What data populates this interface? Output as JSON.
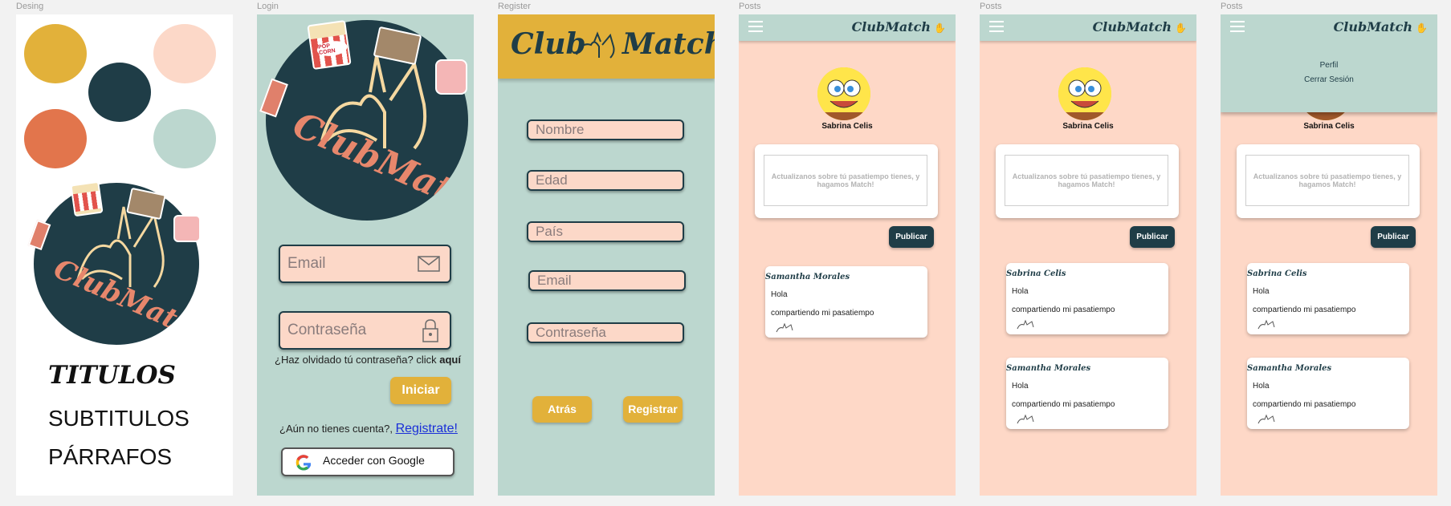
{
  "frames": {
    "design_label": "Desing",
    "login_label": "Login",
    "register_label": "Register",
    "posts_label": "Posts"
  },
  "colors": {
    "gold": "#e2b13a",
    "navy": "#1f3d47",
    "peach": "#fcd8c8",
    "orange": "#e2754c",
    "mint": "#bcd7cf"
  },
  "design": {
    "titles": "TITULOS",
    "subtitles": "SUBTITULOS",
    "paragraphs": "PÁRRAFOS"
  },
  "logo": {
    "script": "ClubMatch",
    "popcorn": "POP CORN"
  },
  "login": {
    "email_placeholder": "Email",
    "password_placeholder": "Contraseña",
    "forgot_text": "¿Haz olvidado tú contraseña? click",
    "forgot_link": "aquí",
    "login_button": "Iniciar",
    "no_account_text": "¿Aún no tienes cuenta?,",
    "register_link": "Registrate!",
    "google_button": "Acceder con Google"
  },
  "register": {
    "header_left": "Club",
    "header_right": "Match",
    "fields": [
      "Nombre",
      "Edad",
      "País",
      "Email",
      "Contraseña"
    ],
    "back_button": "Atrás",
    "register_button": "Registrar"
  },
  "posts": {
    "brand": "ClubMatch",
    "user_name": "Sabrina Celis",
    "composer_placeholder": "Actualizanos sobre tú pasatiempo tienes, y hagamos Match!",
    "publish_button": "Publicar",
    "menu_profile": "Perfil",
    "menu_logout": "Cerrar Sesión",
    "post_line1": "Hola",
    "post_line2": "compartiendo mi pasatiempo",
    "author_samantha": "Samantha Morales",
    "author_sabrina": "Sabrina Celis"
  }
}
